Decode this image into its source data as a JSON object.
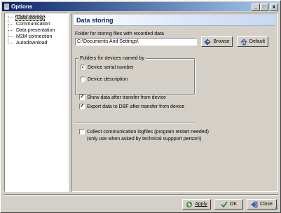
{
  "window": {
    "title": "Options",
    "minimize_label": "_",
    "maximize_label": "□",
    "close_label": "x"
  },
  "tree": {
    "items": [
      {
        "label": "Data storing"
      },
      {
        "label": "Communication"
      },
      {
        "label": "Data presentation"
      },
      {
        "label": "M2M connection"
      },
      {
        "label": "Autodownload"
      }
    ]
  },
  "panel": {
    "header": "Data storing",
    "folder_label": "Folder for storing files with recorded data",
    "folder_value": "C:\\Documents And Settings\\",
    "browse_label": "Browse",
    "default_label": "Default",
    "group_title": "Folders for devices named by",
    "radio_serial": "Device serial number",
    "radio_description": "Device description",
    "selected_radio": "Device serial number",
    "check_show": "Show data after transfer from device",
    "check_show_checked": true,
    "check_export": "Export data to DBF after transfer from device",
    "check_export_checked": true,
    "check_logfiles": "Collect communication logfiles (program restart needed)",
    "check_logfiles_note": "(only use when asked by technical suppport person!)",
    "check_logfiles_checked": false,
    "check_mark": "✓"
  },
  "footer": {
    "apply_label": "Apply",
    "ok_label": "OK",
    "close_label": "Close"
  }
}
